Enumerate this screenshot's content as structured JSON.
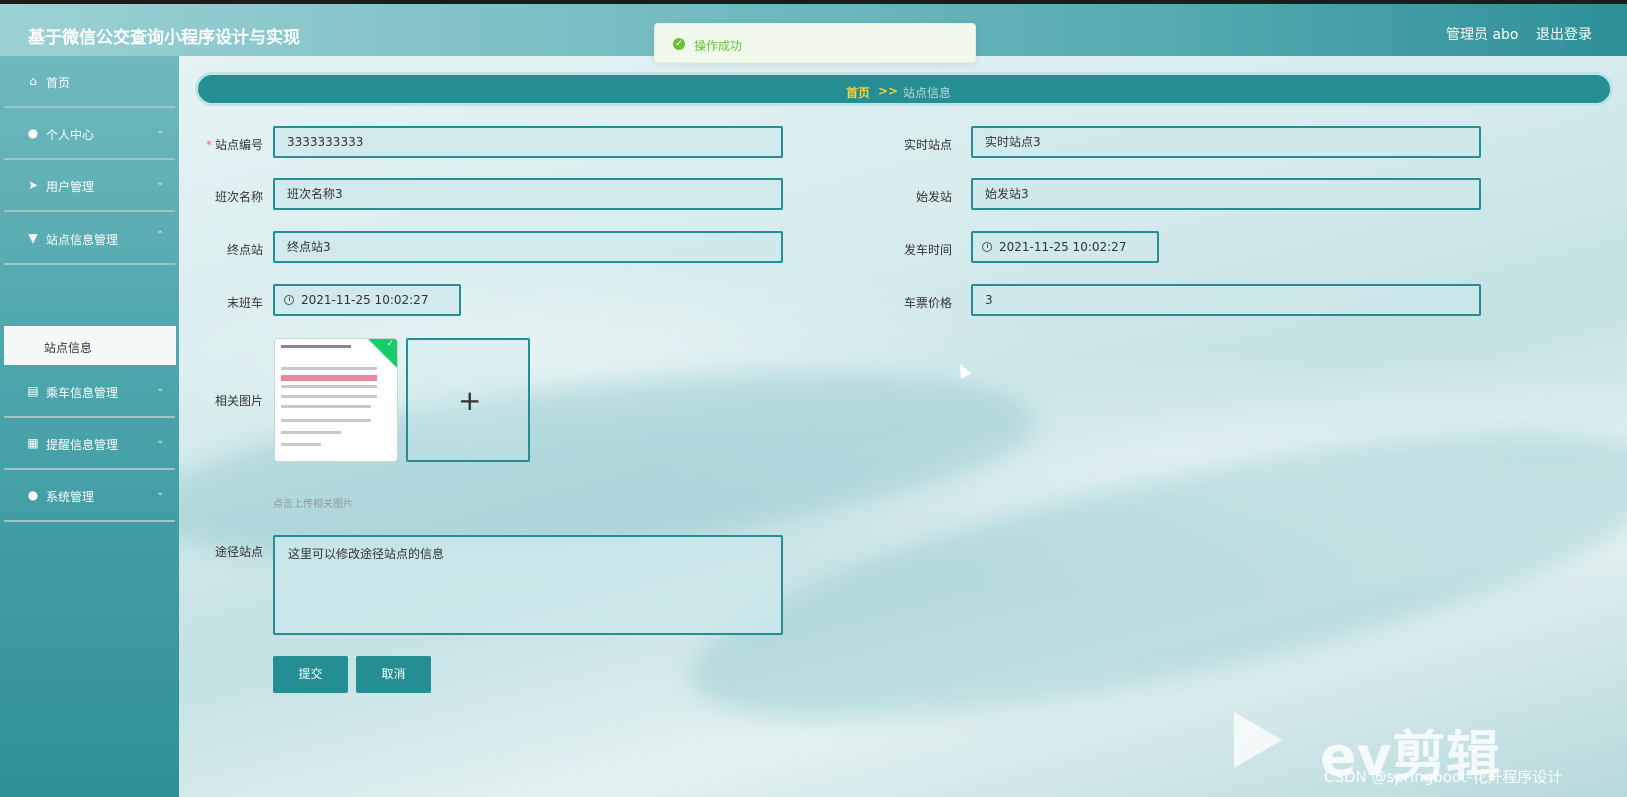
{
  "app": {
    "title": "基于微信公交查询小程序设计与实现",
    "admin_label": "管理员 abo",
    "logout": "退出登录"
  },
  "toast": {
    "message": "操作成功"
  },
  "sidebar": {
    "items": [
      {
        "label": "首页",
        "icon": "home-icon"
      },
      {
        "label": "个人中心",
        "icon": "user-icon"
      },
      {
        "label": "用户管理",
        "icon": "send-icon"
      },
      {
        "label": "站点信息管理",
        "icon": "bus-stop-icon"
      },
      {
        "label": "乘车信息管理",
        "icon": "document-icon"
      },
      {
        "label": "提醒信息管理",
        "icon": "grid-icon"
      },
      {
        "label": "系统管理",
        "icon": "person-icon"
      }
    ],
    "active_submenu": "站点信息"
  },
  "breadcrumb": {
    "home": "首页",
    "separator": ">>",
    "current": "站点信息"
  },
  "form": {
    "station_no": {
      "label": "站点编号",
      "value": "3333333333"
    },
    "realtime_station": {
      "label": "实时站点",
      "value": "实时站点3"
    },
    "shift_name": {
      "label": "班次名称",
      "value": "班次名称3"
    },
    "origin_station": {
      "label": "始发站",
      "value": "始发站3"
    },
    "terminal_station": {
      "label": "终点站",
      "value": "终点站3"
    },
    "departure_time": {
      "label": "发车时间",
      "value": "2021-11-25 10:02:27"
    },
    "last_bus": {
      "label": "末班车",
      "value": "2021-11-25 10:02:27"
    },
    "ticket_price": {
      "label": "车票价格",
      "value": "3"
    },
    "images": {
      "label": "相关图片",
      "hint": "点击上传相关图片"
    },
    "route_stations": {
      "label": "途径站点",
      "value": "这里可以修改途径站点的信息"
    }
  },
  "buttons": {
    "submit": "提交",
    "cancel": "取消"
  },
  "watermark": {
    "brand": "ev剪辑",
    "credit": "CSDN @springboot-花开程序设计"
  },
  "colors": {
    "primary": "#248e93",
    "accent": "#f3d23c",
    "success": "#67c23a"
  }
}
